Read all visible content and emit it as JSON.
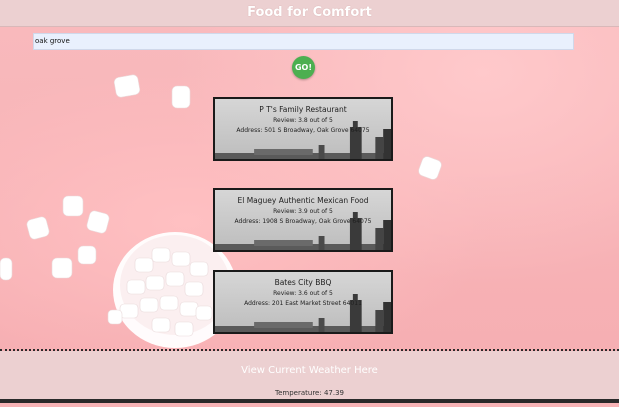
{
  "header": {
    "title": "Food for Comfort"
  },
  "search": {
    "value": "oak grove"
  },
  "go_button": {
    "label": "GO!"
  },
  "restaurants": [
    {
      "name": "P T's Family Restaurant",
      "review": "Review: 3.8 out of 5",
      "address": "Address: 501 S Broadway, Oak Grove 64075"
    },
    {
      "name": "El Maguey Authentic Mexican Food",
      "review": "Review: 3.9 out of 5",
      "address": "Address: 1908 S Broadway, Oak Grove 64075"
    },
    {
      "name": "Bates City BBQ",
      "review": "Review: 3.6 out of 5",
      "address": "Address: 201 East Market Street 64011"
    }
  ],
  "footer": {
    "weather_link": "View Current Weather Here",
    "temperature": "Temperature: 47.39"
  },
  "colors": {
    "accent_go": "#4caf50",
    "header_bg": "#ecd0d1",
    "page_bg": "#f7b3b6"
  }
}
